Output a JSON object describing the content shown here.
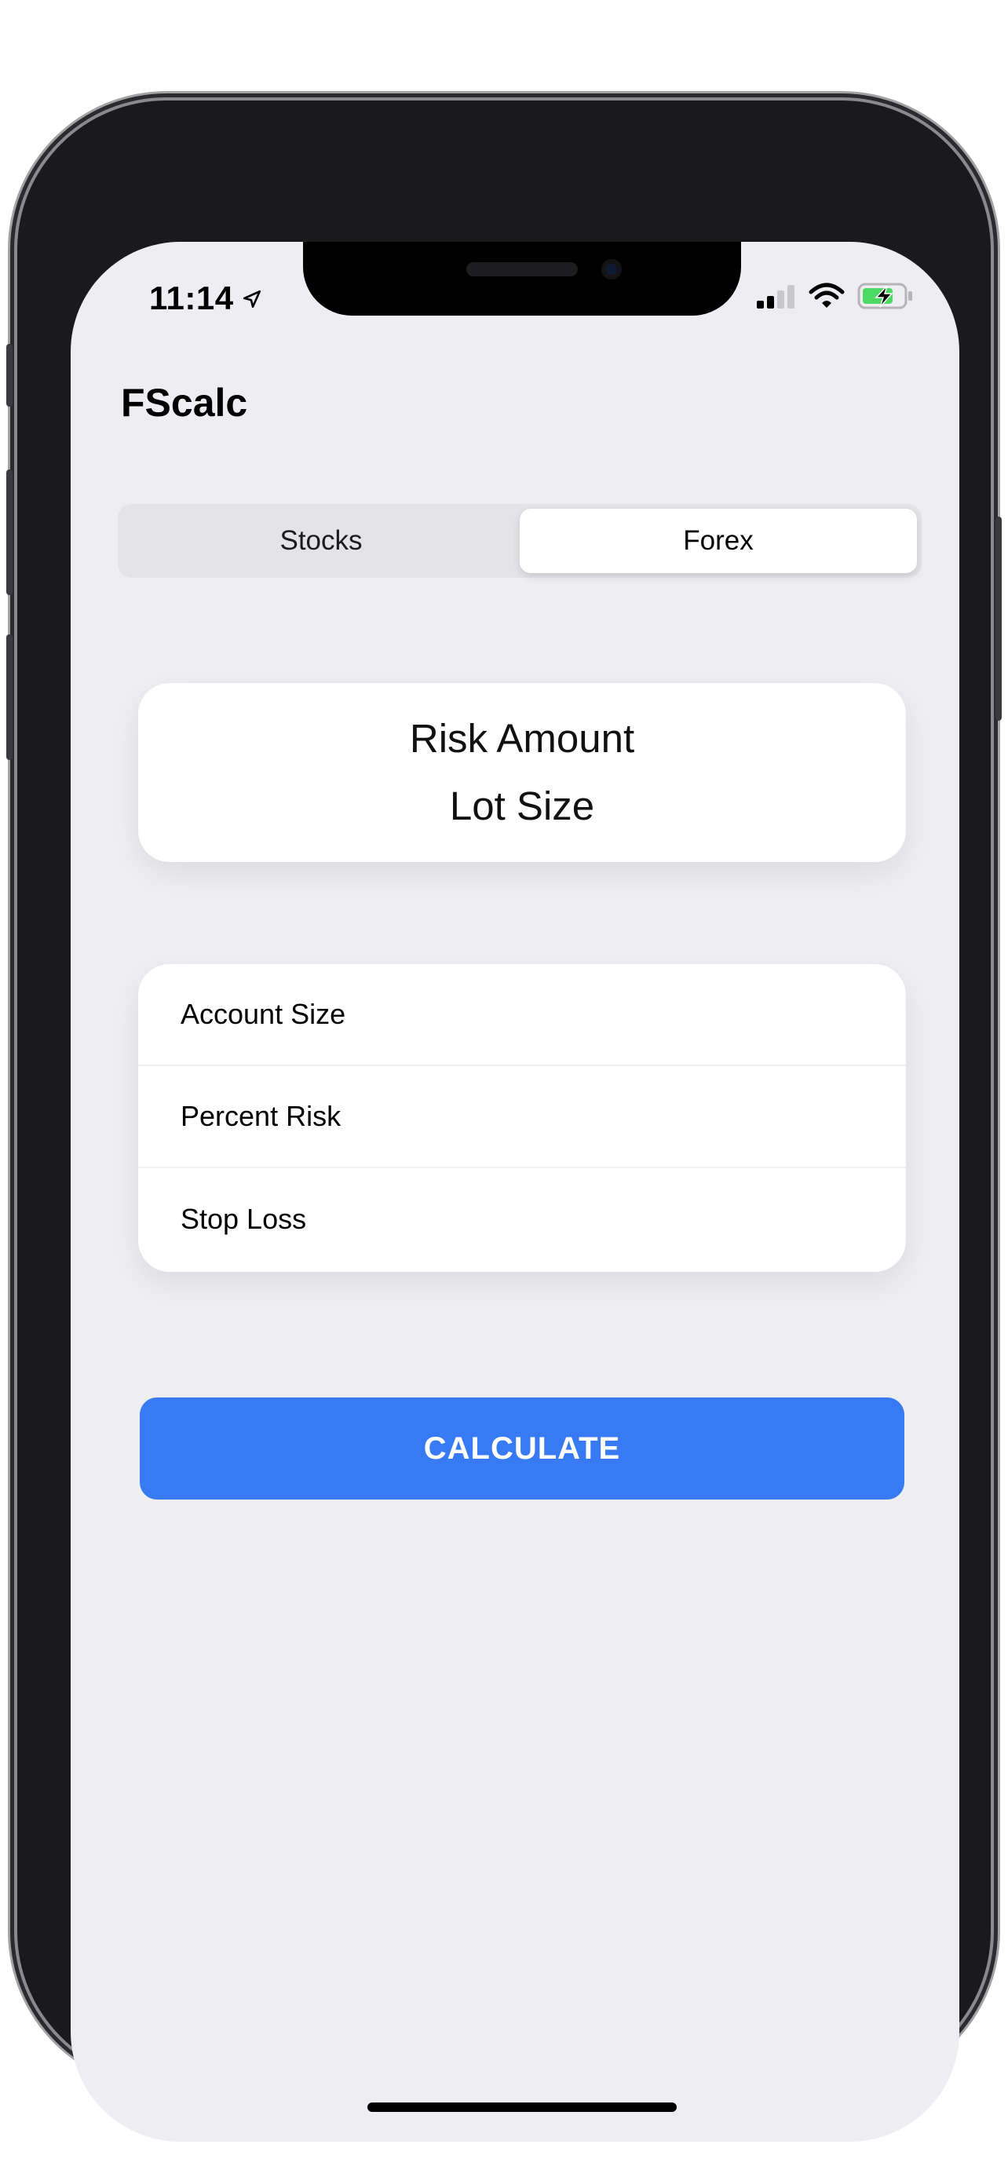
{
  "status_bar": {
    "time": "11:14",
    "location_icon": "location-arrow-icon",
    "signal_icon": "cellular-signal-icon",
    "wifi_icon": "wifi-icon",
    "battery_icon": "battery-charging-icon"
  },
  "app": {
    "title": "FScalc"
  },
  "segmented": {
    "options": [
      {
        "label": "Stocks",
        "selected": false
      },
      {
        "label": "Forex",
        "selected": true
      }
    ]
  },
  "result": {
    "risk_amount_label": "Risk Amount",
    "lot_size_label": "Lot Size"
  },
  "inputs": {
    "account_size": {
      "placeholder": "Account Size",
      "value": ""
    },
    "percent_risk": {
      "placeholder": "Percent Risk",
      "value": ""
    },
    "stop_loss": {
      "placeholder": "Stop Loss",
      "value": ""
    }
  },
  "actions": {
    "calculate_label": "CALCULATE"
  },
  "colors": {
    "accent": "#377AF4",
    "screen_background": "#EEEDF2",
    "battery_fill": "#4CD964"
  }
}
